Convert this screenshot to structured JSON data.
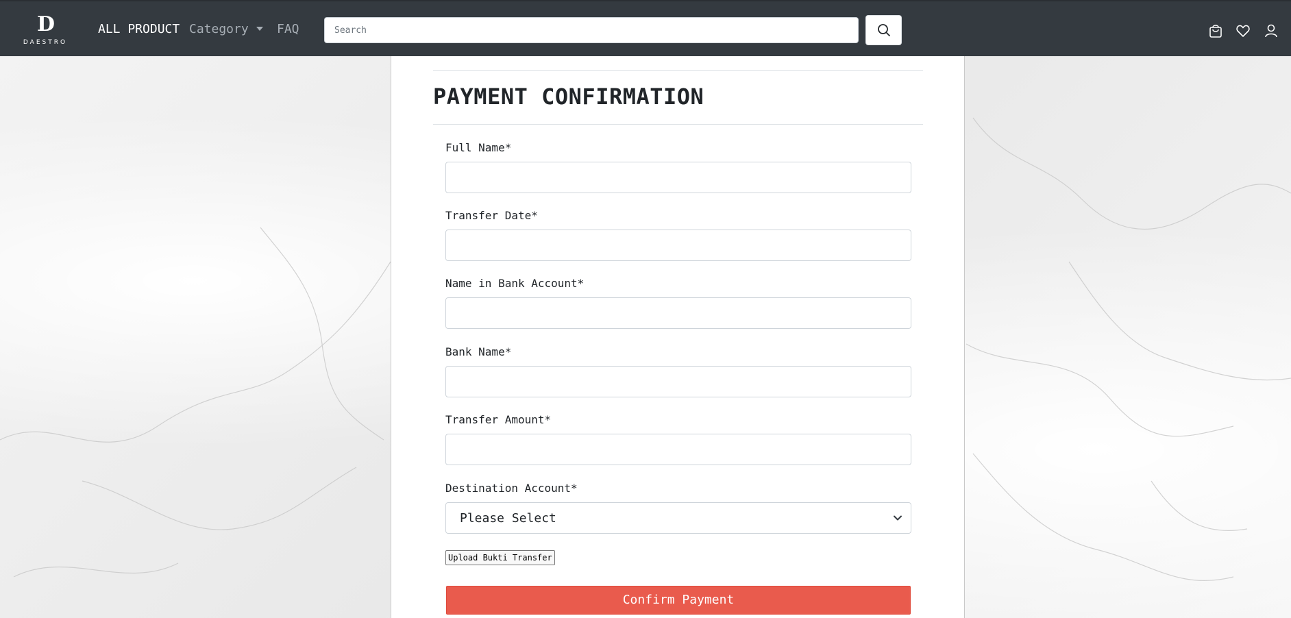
{
  "brand": {
    "mark": "D",
    "name": "DAESTRO"
  },
  "nav": {
    "all_product": "ALL PRODUCT",
    "category": "Category",
    "faq": "FAQ"
  },
  "search": {
    "placeholder": "Search",
    "icon": "search-icon"
  },
  "header_icons": [
    "bag-icon",
    "heart-icon",
    "user-icon"
  ],
  "page": {
    "title": "PAYMENT CONFIRMATION"
  },
  "form": {
    "full_name_label": "Full Name*",
    "transfer_date_label": "Transfer Date*",
    "bank_account_name_label": "Name in Bank Account*",
    "bank_name_label": "Bank Name*",
    "transfer_amount_label": "Transfer Amount*",
    "destination_label": "Destination Account*",
    "destination_value": "Please Select",
    "upload_label": "Upload Bukti Transfer",
    "submit_label": "Confirm Payment"
  },
  "colors": {
    "header_bg": "#343a40",
    "accent": "#e95b4d"
  }
}
